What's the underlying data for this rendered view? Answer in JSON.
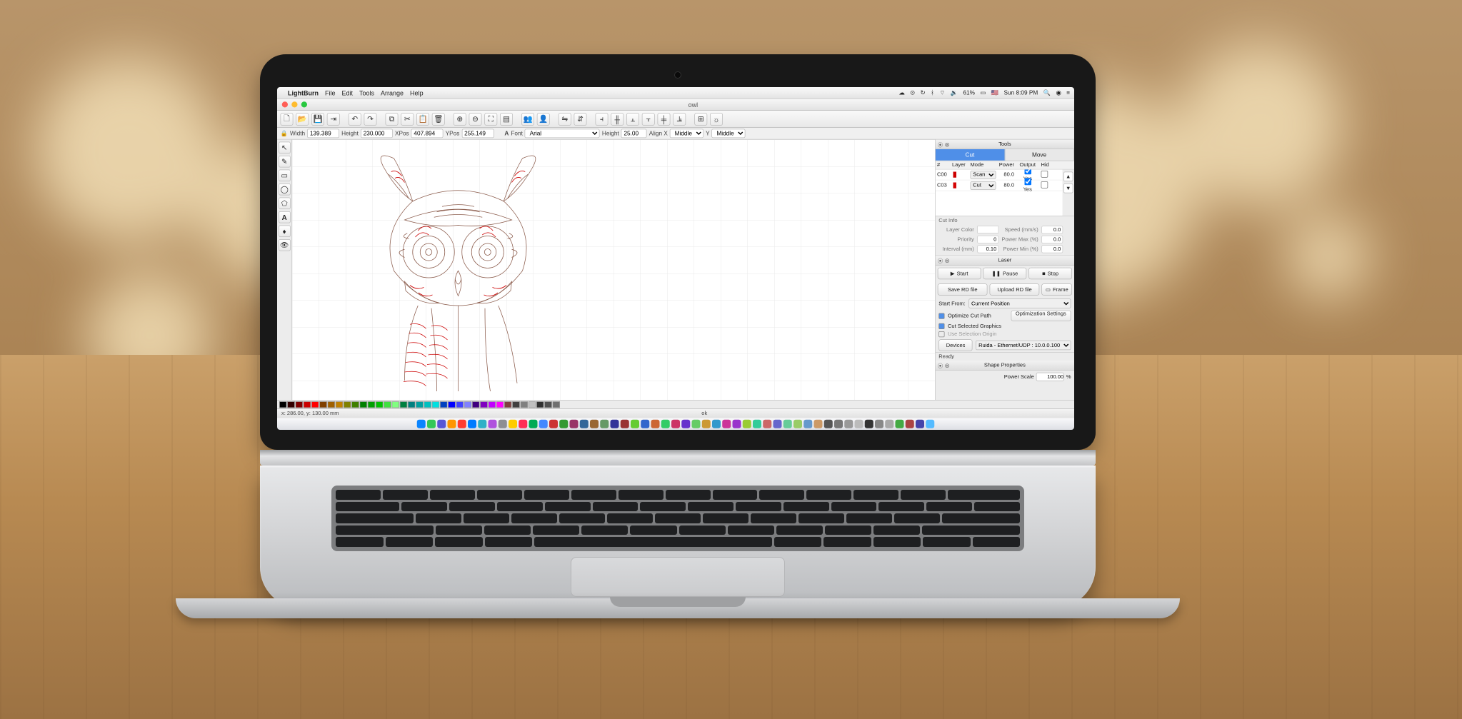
{
  "menubar": {
    "app": "LightBurn",
    "items": [
      "File",
      "Edit",
      "Tools",
      "Arrange",
      "Help"
    ],
    "battery": "61%",
    "clock": "Sun 8:09 PM"
  },
  "window": {
    "title": "owl"
  },
  "properties": {
    "width_label": "Width",
    "width": "139.389",
    "height_label": "Height",
    "height": "230.000",
    "xpos_label": "XPos",
    "xpos": "407.894",
    "ypos_label": "YPos",
    "ypos": "255.149",
    "font_label": "Font",
    "font": "Arial",
    "font_height_label": "Height",
    "font_height": "25.00",
    "alignx_label": "Align X",
    "alignx": "Middle",
    "aligny_label": "Y",
    "aligny": "Middle"
  },
  "panels": {
    "tools_title": "Tools",
    "tab_cut": "Cut",
    "tab_move": "Move",
    "headers": {
      "num": "#",
      "layer": "Layer",
      "mode": "Mode",
      "power": "Power",
      "output": "Output",
      "hide": "Hid"
    },
    "layers": [
      {
        "id": "C00",
        "mode": "Scan",
        "power": "80.0",
        "output": "Yes"
      },
      {
        "id": "C03",
        "mode": "Cut",
        "power": "80.0",
        "output": "Yes"
      }
    ],
    "cutinfo_title": "Cut Info",
    "cutinfo": {
      "layer_color": "Layer Color",
      "speed": "Speed (mm/s)",
      "speed_v": "0.0",
      "priority": "Priority",
      "priority_v": "0",
      "power_max": "Power Max (%)",
      "power_max_v": "0.0",
      "interval": "Interval (mm)",
      "interval_v": "0.10",
      "power_min": "Power Min (%)",
      "power_min_v": "0.0"
    },
    "laser_title": "Laser",
    "start": "Start",
    "pause": "Pause",
    "stop": "Stop",
    "save_rd": "Save RD file",
    "upload_rd": "Upload RD file",
    "frame": "Frame",
    "start_from_label": "Start From:",
    "start_from": "Current Position",
    "optimize": "Optimize Cut Path",
    "optimize_btn": "Optimization Settings",
    "cut_selected": "Cut Selected Graphics",
    "use_sel_origin": "Use Selection Origin",
    "devices": "Devices",
    "device": "Ruida - Ethernet/UDP : 10.0.0.100",
    "ready": "Ready",
    "shape_title": "Shape Properties",
    "power_scale_label": "Power Scale",
    "power_scale": "100.00",
    "pct": "%"
  },
  "statusbar": {
    "coords": "x: 286.00, y: 130.00 mm",
    "mid": "ok"
  },
  "swatch_colors": [
    "#000",
    "#330000",
    "#800000",
    "#c00",
    "#f00",
    "#804000",
    "#a06000",
    "#c08000",
    "#808000",
    "#408000",
    "#008000",
    "#00a000",
    "#00c000",
    "#40e040",
    "#80ff80",
    "#008040",
    "#008080",
    "#00a0a0",
    "#00c0c0",
    "#00e0e0",
    "#0040c0",
    "#0000ff",
    "#4040ff",
    "#8080ff",
    "#400080",
    "#8000c0",
    "#c000ff",
    "#ff00ff",
    "#804040",
    "#404040",
    "#808080",
    "#c0c0c0",
    "#303030",
    "#505050",
    "#707070"
  ],
  "dock_colors": [
    "#0a84ff",
    "#34c759",
    "#5856d6",
    "#ff9500",
    "#ff3b30",
    "#007aff",
    "#30b0c7",
    "#af52de",
    "#8e8e93",
    "#ffcc00",
    "#ff2d55",
    "#0a5",
    "#48f",
    "#c33",
    "#393",
    "#936",
    "#369",
    "#963",
    "#696",
    "#339",
    "#933",
    "#6c3",
    "#36c",
    "#c63",
    "#3c6",
    "#c36",
    "#63c",
    "#6c6",
    "#c93",
    "#39c",
    "#c39",
    "#93c",
    "#9c3",
    "#3c9",
    "#c66",
    "#66c",
    "#6c9",
    "#9c6",
    "#69c",
    "#c96",
    "#555",
    "#777",
    "#999",
    "#bbb",
    "#333",
    "#888",
    "#aaa",
    "#4a4",
    "#a44",
    "#44a",
    "#5bf"
  ]
}
